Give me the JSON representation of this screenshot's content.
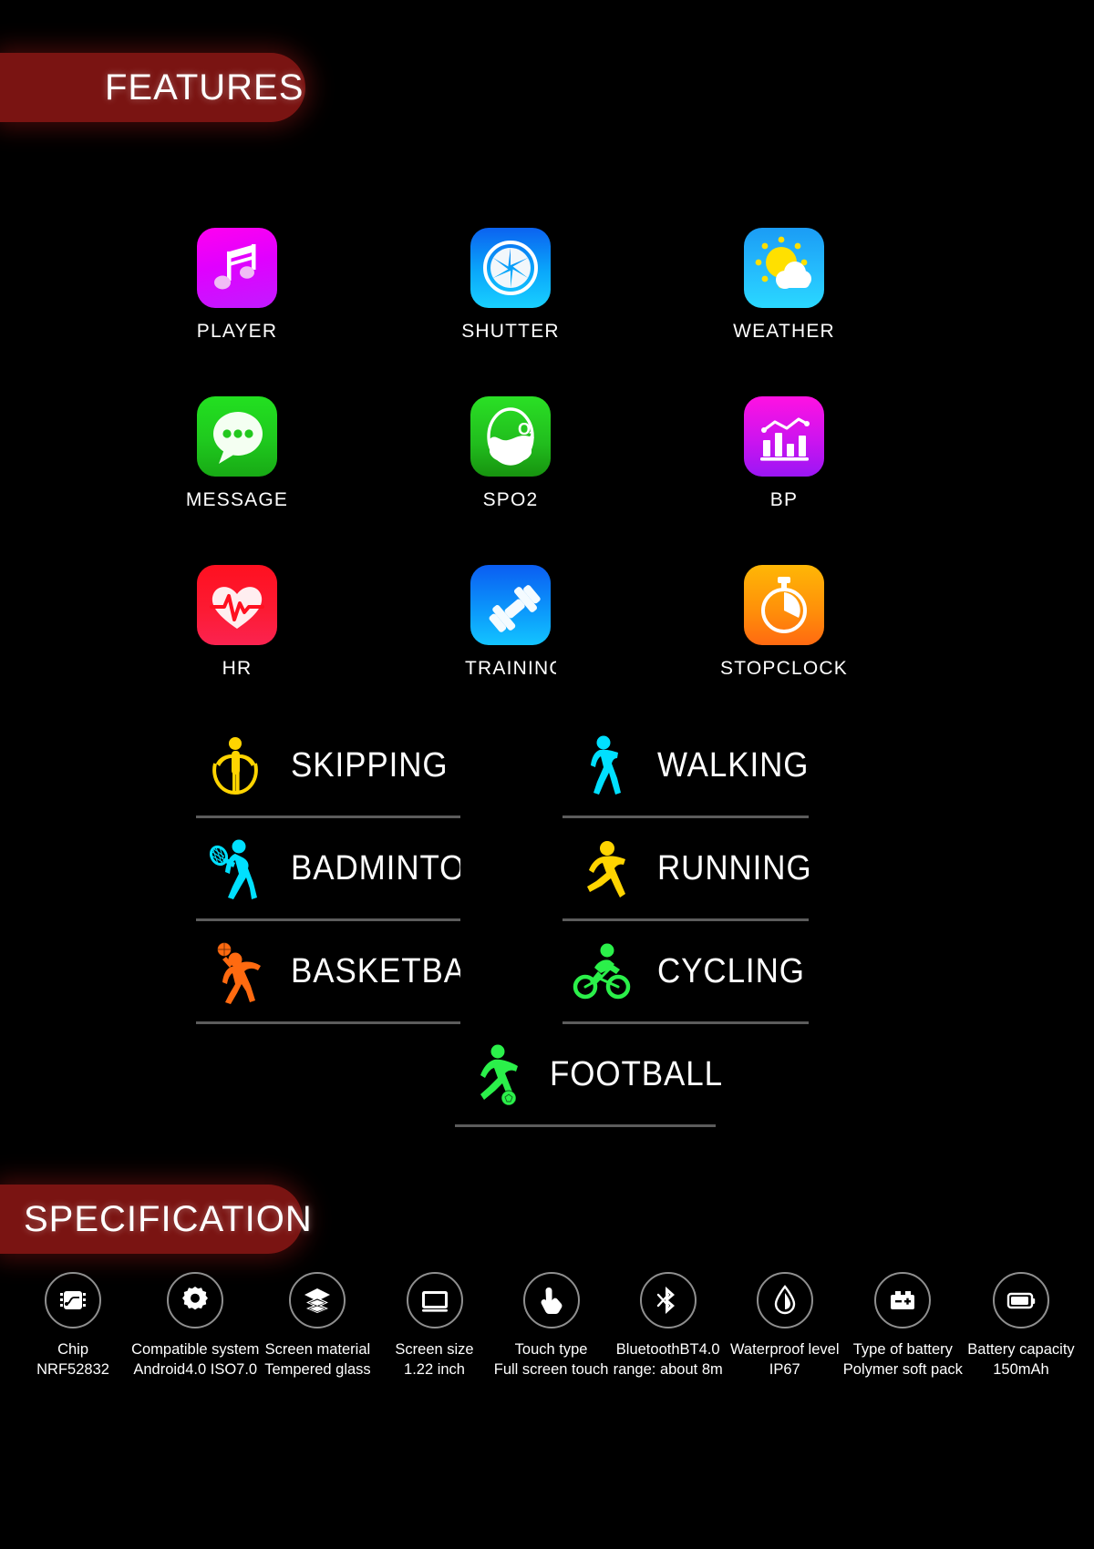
{
  "sections": {
    "features_banner": "FEATURES",
    "specification_banner": "SPECIFICATION"
  },
  "apps": [
    {
      "label": "PLAYER",
      "icon": "music-note-icon",
      "tile_color": "#e000ff"
    },
    {
      "label": "SHUTTER",
      "icon": "camera-aperture-icon",
      "tile_color": "#0aa8fb"
    },
    {
      "label": "WEATHER",
      "icon": "sun-cloud-icon",
      "tile_color": "#25bdfd"
    },
    {
      "label": "MESSAGE",
      "icon": "speech-bubble-icon",
      "tile_color": "#1fc91e"
    },
    {
      "label": "SPO2",
      "icon": "oxygen-drop-icon",
      "tile_color": "#21bc1d"
    },
    {
      "label": "BP",
      "icon": "bar-chart-icon",
      "tile_color": "#cc14ef"
    },
    {
      "label": "HR",
      "icon": "heart-pulse-icon",
      "tile_color": "#fc1a32"
    },
    {
      "label": "TRAINING",
      "icon": "dumbbell-icon",
      "tile_color": "#0b96fb"
    },
    {
      "label": "STOPCLOCK",
      "icon": "stopwatch-icon",
      "tile_color": "#ff9109"
    }
  ],
  "sports": [
    {
      "label": "SKIPPING",
      "icon": "skipping-rope-figure-icon",
      "color": "#ffd400"
    },
    {
      "label": "WALKING",
      "icon": "walking-figure-icon",
      "color": "#00e0ff"
    },
    {
      "label": "BADMINTON",
      "icon": "badminton-figure-icon",
      "color": "#00e0ff"
    },
    {
      "label": "RUNNING",
      "icon": "running-figure-icon",
      "color": "#ffd400"
    },
    {
      "label": "BASKETBALL",
      "icon": "basketball-figure-icon",
      "color": "#ff6a10"
    },
    {
      "label": "CYCLING",
      "icon": "cycling-figure-icon",
      "color": "#2bf04a"
    },
    {
      "label": "FOOTBALL",
      "icon": "football-figure-icon",
      "color": "#2bf04a"
    }
  ],
  "specs": [
    {
      "icon": "chip-icon",
      "title": "Chip",
      "value": "NRF52832"
    },
    {
      "icon": "gear-icon",
      "title": "Compatible system",
      "value": "Android4.0 ISO7.0"
    },
    {
      "icon": "layers-icon",
      "title": "Screen material",
      "value": "Tempered glass"
    },
    {
      "icon": "monitor-icon",
      "title": "Screen size",
      "value": "1.22 inch"
    },
    {
      "icon": "touch-hand-icon",
      "title": "Touch type",
      "value": "Full screen touch"
    },
    {
      "icon": "bluetooth-icon",
      "title": "BluetoothBT4.0",
      "value": "range: about 8m"
    },
    {
      "icon": "water-drop-icon",
      "title": "Waterproof level",
      "value": "IP67"
    },
    {
      "icon": "battery-type-icon",
      "title": "Type of battery",
      "value": "Polymer soft pack"
    },
    {
      "icon": "battery-icon",
      "title": "Battery capacity",
      "value": "150mAh"
    }
  ],
  "theme": {
    "background": "#000000",
    "banner_color": "#7a1412",
    "text_color": "#ffffff",
    "rule_color": "#5c5c5c"
  }
}
